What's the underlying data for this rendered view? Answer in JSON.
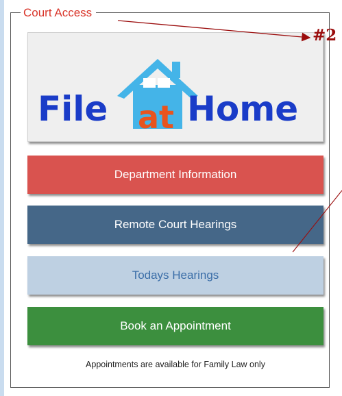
{
  "fieldset": {
    "legend": "Court Access"
  },
  "annotation": {
    "badge": "#2"
  },
  "file_at_home": {
    "word1": "File",
    "word2": "at",
    "word3": "Home"
  },
  "buttons": {
    "department": "Department Information",
    "remote": "Remote Court Hearings",
    "todays": "Todays Hearings",
    "book": "Book an Appointment"
  },
  "note": "Appointments are available for Family Law only",
  "colors": {
    "background": "#c9dcef",
    "department": "#d9534f",
    "remote": "#456788",
    "todays": "#bed0e2",
    "book": "#3c8f3e",
    "legend_text": "#d9352a",
    "annotation": "#9b0d0d",
    "logo_blue": "#1a3cc8",
    "logo_orange": "#e8541e",
    "house_blue": "#44b4e8"
  }
}
